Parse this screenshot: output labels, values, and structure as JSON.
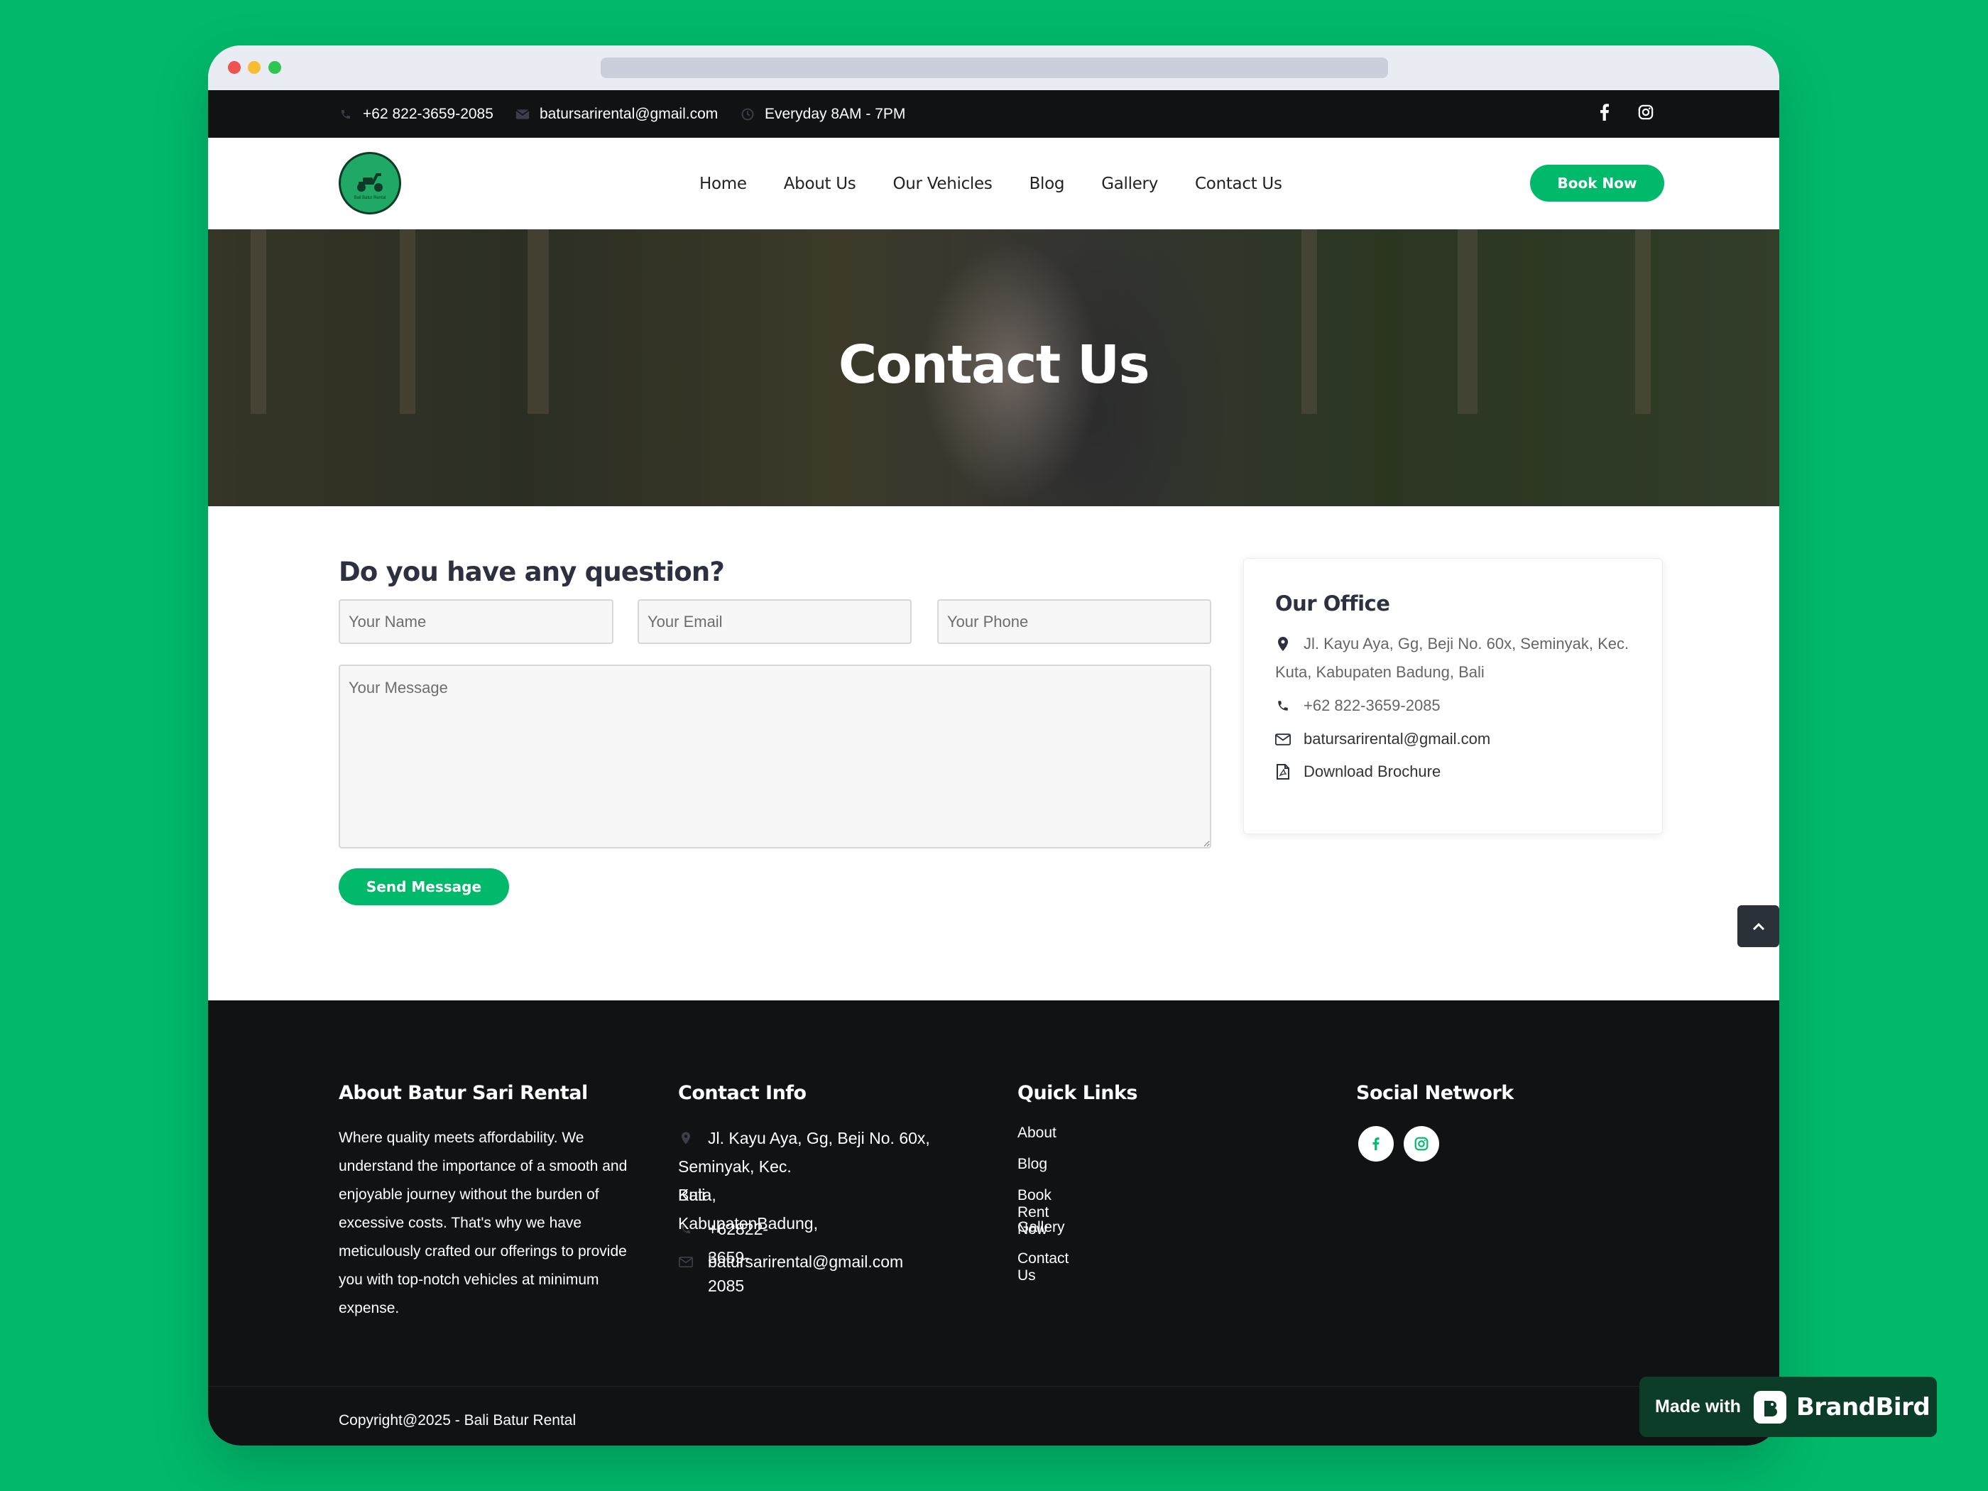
{
  "topbar": {
    "phone": "+62 822-3659-2085",
    "email": "batursarirental@gmail.com",
    "hours": "Everyday 8AM - 7PM",
    "social_icons": [
      "facebook-icon",
      "instagram-icon"
    ]
  },
  "nav": {
    "logo_text": "Bali Batur Rental",
    "items": [
      {
        "label": "Home"
      },
      {
        "label": "About Us"
      },
      {
        "label": "Our Vehicles"
      },
      {
        "label": "Blog"
      },
      {
        "label": "Gallery"
      },
      {
        "label": "Contact Us"
      }
    ],
    "book_now": "Book Now"
  },
  "hero": {
    "title": "Contact Us"
  },
  "form": {
    "title": "Do you have any question?",
    "name_placeholder": "Your Name",
    "email_placeholder": "Your Email",
    "phone_placeholder": "Your Phone",
    "message_placeholder": "Your Message",
    "send_label": "Send Message"
  },
  "office": {
    "title": "Our Office",
    "address_line1": "Jl. Kayu Aya, Gg, Beji No. 60x, Seminyak, Kec.",
    "address_line2": "Kuta, Kabupaten Badung, Bali",
    "phone": "+62 822-3659-2085",
    "email": "batursarirental@gmail.com",
    "brochure": "Download Brochure"
  },
  "footer": {
    "about_title": "About Batur Sari Rental",
    "about_text": "Where quality meets affordability. We understand the importance of a smooth and enjoyable journey without the burden of excessive costs. That's why we have meticulously crafted our offerings to provide you with top-notch vehicles at minimum expense.",
    "contact_title": "Contact Info",
    "contact_address_line1": "Jl. Kayu Aya, Gg, Beji No. 60x,",
    "contact_address_line2": "Seminyak, Kec. Kuta, KabupatenBadung,",
    "contact_address_line3": "Bali",
    "contact_phone": "+62822-3659-2085",
    "contact_email": "batursarirental@gmail.com",
    "links_title": "Quick Links",
    "links": [
      {
        "label": "About"
      },
      {
        "label": "Blog"
      },
      {
        "label": "Book Rent Now"
      },
      {
        "label": "Gallery"
      },
      {
        "label": "Contact Us"
      }
    ],
    "social_title": "Social Network",
    "copyright": "Copyright@2025 - Bali Batur Rental"
  },
  "badge": {
    "made_with": "Made with",
    "brand": "BrandBird"
  },
  "colors": {
    "accent": "#00b96b",
    "dark": "#111214",
    "background": "#00b96b"
  }
}
